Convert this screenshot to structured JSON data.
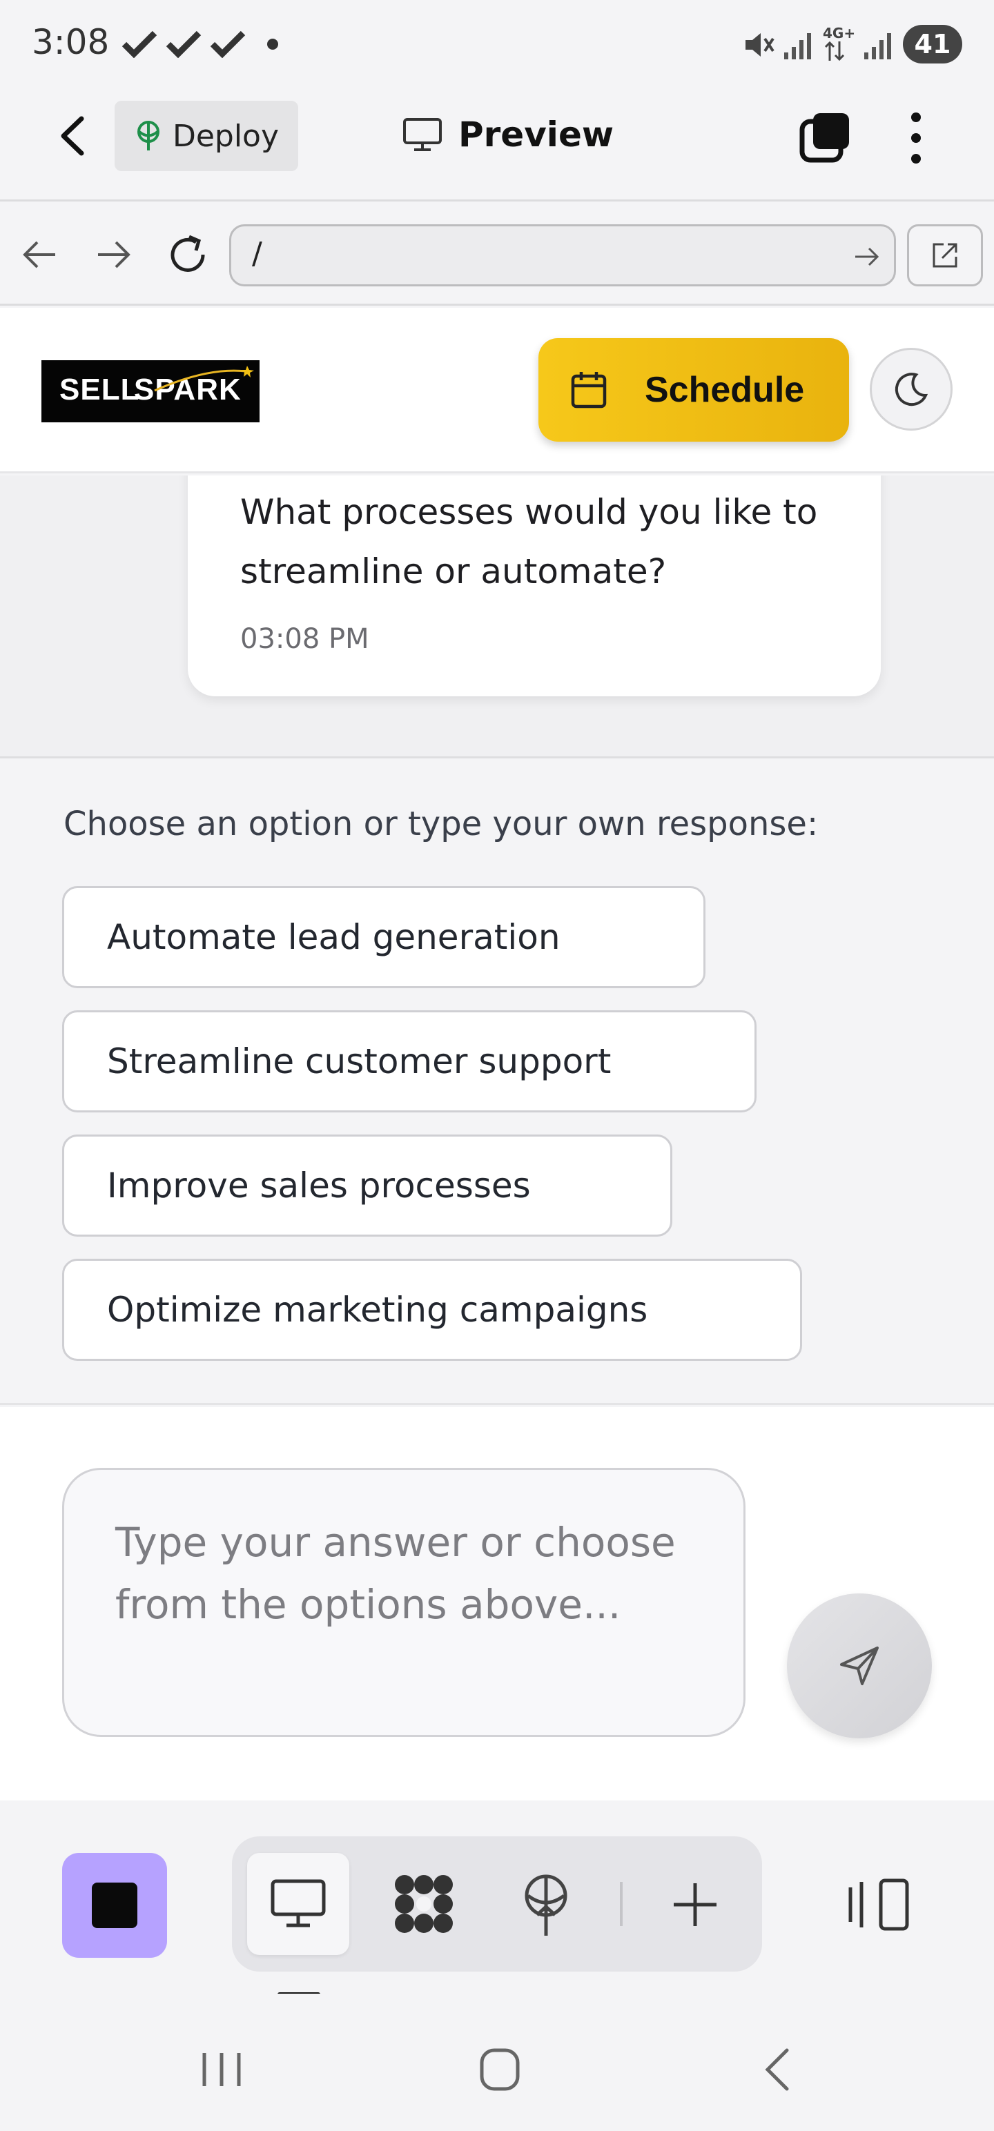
{
  "status_bar": {
    "time": "3:08",
    "network": "4G+",
    "battery": "41"
  },
  "app_header": {
    "deploy_label": "Deploy",
    "preview_label": "Preview"
  },
  "browser_bar": {
    "url": "/"
  },
  "site_header": {
    "logo_text_1": "SELL",
    "logo_text_2": "SPARK",
    "schedule_label": "Schedule"
  },
  "chat": {
    "message": "What processes would you like to streamline or automate?",
    "timestamp": "03:08 PM"
  },
  "options": {
    "prompt": "Choose an option or type your own response:",
    "items": [
      {
        "label": "Automate lead generation"
      },
      {
        "label": "Streamline customer support"
      },
      {
        "label": "Improve sales processes"
      },
      {
        "label": "Optimize marketing campaigns"
      }
    ]
  },
  "input": {
    "placeholder": "Type your answer or choose from the options above..."
  },
  "colors": {
    "accent_yellow": "#f2c014",
    "stop_purple": "#b6a2ff"
  }
}
